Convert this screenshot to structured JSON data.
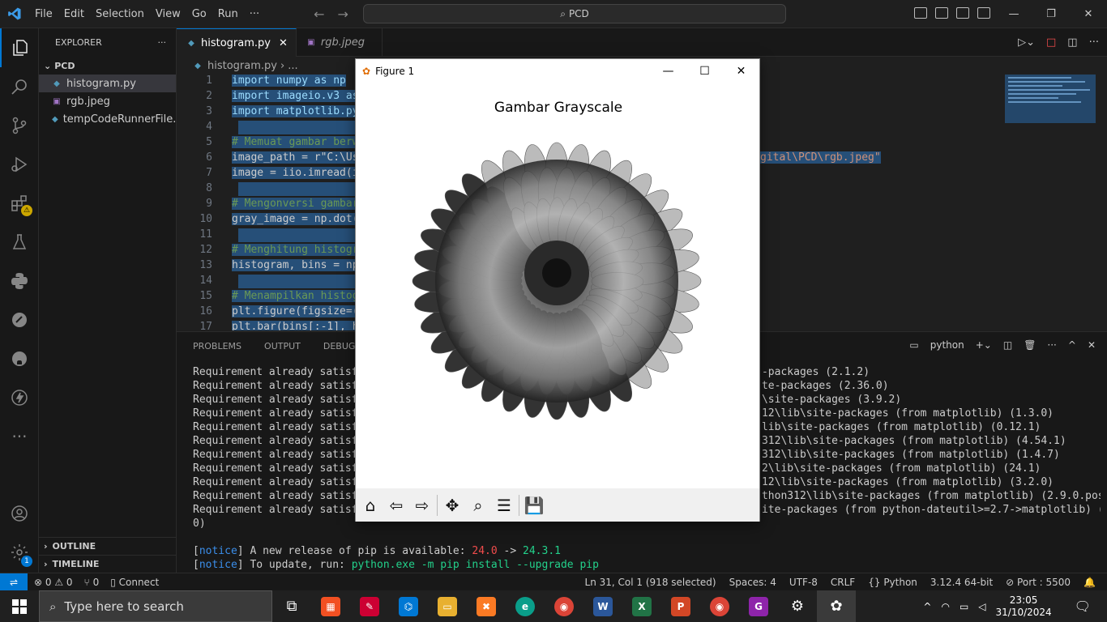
{
  "menu": [
    "File",
    "Edit",
    "Selection",
    "View",
    "Go",
    "Run",
    "···"
  ],
  "search": {
    "text": "PCD"
  },
  "explorer": {
    "title": "EXPLORER",
    "folder": "PCD",
    "files": [
      {
        "name": "histogram.py",
        "kind": "py"
      },
      {
        "name": "rgb.jpeg",
        "kind": "img"
      },
      {
        "name": "tempCodeRunnerFile....",
        "kind": "py"
      }
    ],
    "outline": "OUTLINE",
    "timeline": "TIMELINE"
  },
  "tabs": [
    {
      "label": "histogram.py"
    },
    {
      "label": "rgb.jpeg"
    }
  ],
  "breadcrumb": {
    "file": "histogram.py",
    "rest": "..."
  },
  "code": [
    {
      "n": "1",
      "t": "import numpy as np"
    },
    {
      "n": "2",
      "t": "import imageio.v3 as"
    },
    {
      "n": "3",
      "t": "import matplotlib.py"
    },
    {
      "n": "4",
      "t": ""
    },
    {
      "n": "5",
      "t": "# Memuat gambar berw"
    },
    {
      "n": "6",
      "t": "image_path = r\"C:\\Us",
      "tail": "gital\\PCD\\rgb.jpeg\""
    },
    {
      "n": "7",
      "t": "image = iio.imread(i"
    },
    {
      "n": "8",
      "t": ""
    },
    {
      "n": "9",
      "t": "# Mengonversi gambar"
    },
    {
      "n": "10",
      "t": "gray_image = np.dot("
    },
    {
      "n": "11",
      "t": ""
    },
    {
      "n": "12",
      "t": "# Menghitung histogr"
    },
    {
      "n": "13",
      "t": "histogram, bins = np"
    },
    {
      "n": "14",
      "t": ""
    },
    {
      "n": "15",
      "t": "# Menampilkan histog"
    },
    {
      "n": "16",
      "t": "plt.figure(figsize=("
    },
    {
      "n": "17",
      "t": "plt.bar(bins[:-1], h"
    }
  ],
  "panel": {
    "tabs": [
      "PROBLEMS",
      "OUTPUT",
      "DEBUG CON"
    ],
    "shell": "python",
    "lines": [
      {
        "l": "Requirement already satisfied",
        "r": "-packages (2.1.2)"
      },
      {
        "l": "Requirement already satisfied",
        "r": "te-packages (2.36.0)"
      },
      {
        "l": "Requirement already satisfied",
        "r": "\\site-packages (3.9.2)"
      },
      {
        "l": "Requirement already satisfied",
        "r": "12\\lib\\site-packages (from matplotlib) (1.3.0)"
      },
      {
        "l": "Requirement already satisfied",
        "r": "lib\\site-packages (from matplotlib) (0.12.1)"
      },
      {
        "l": "Requirement already satisfied",
        "r": "312\\lib\\site-packages (from matplotlib) (4.54.1)"
      },
      {
        "l": "Requirement already satisfied",
        "r": "312\\lib\\site-packages (from matplotlib) (1.4.7)"
      },
      {
        "l": "Requirement already satisfied",
        "r": "2\\lib\\site-packages (from matplotlib) (24.1)"
      },
      {
        "l": "Requirement already satisfied",
        "r": "12\\lib\\site-packages (from matplotlib) (3.2.0)"
      },
      {
        "l": "Requirement already satisfied",
        "r": "thon312\\lib\\site-packages (from matplotlib) (2.9.0.post0)"
      },
      {
        "l": "Requirement already satisfied",
        "r": "ite-packages (from python-dateutil>=2.7->matplotlib) (1.16."
      }
    ],
    "wrap": "0)",
    "notice1": {
      "tag": "notice",
      "text": " A new release of pip is available: ",
      "old": "24.0",
      "arrow": " -> ",
      "new": "24.3.1"
    },
    "notice2": {
      "tag": "notice",
      "text": " To update, run: ",
      "cmd": "python.exe -m pip install --upgrade pip"
    }
  },
  "status": {
    "errors": "0",
    "warnings": "0",
    "ports": "0",
    "connect": "Connect",
    "position": "Ln 31, Col 1 (918 selected)",
    "spaces": "Spaces: 4",
    "encoding": "UTF-8",
    "eol": "CRLF",
    "lang": "Python",
    "version": "3.12.4 64-bit",
    "port": "Port : 5500"
  },
  "figure": {
    "window_title": "Figure 1",
    "plot_title": "Gambar Grayscale"
  },
  "taskbar": {
    "search": "Type here to search",
    "time": "23:05",
    "date": "31/10/2024"
  },
  "colors": {
    "accent": "#0078d4",
    "bg": "#1f1f1f"
  }
}
